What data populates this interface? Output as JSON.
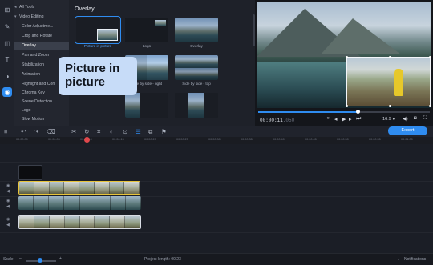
{
  "rail": {
    "icons": [
      "import-icon",
      "effects-icon",
      "filters-icon",
      "titles-icon",
      "stickers-icon",
      "more-tools-icon"
    ],
    "active": "more-tools-icon"
  },
  "tools": {
    "items": [
      {
        "label": "All Tools",
        "caret": "◂",
        "selected": false
      },
      {
        "label": "Video Editing",
        "caret": "▾",
        "selected": false
      },
      {
        "label": "Color Adjustme...",
        "caret": "",
        "selected": false
      },
      {
        "label": "Crop and Rotate",
        "caret": "",
        "selected": false
      },
      {
        "label": "Overlay",
        "caret": "",
        "selected": true
      },
      {
        "label": "Pan and Zoom",
        "caret": "",
        "selected": false
      },
      {
        "label": "Stabilization",
        "caret": "",
        "selected": false
      },
      {
        "label": "Animation",
        "caret": "",
        "selected": false
      },
      {
        "label": "Highlight and Con",
        "caret": "",
        "selected": false
      },
      {
        "label": "Chroma Key",
        "caret": "",
        "selected": false
      },
      {
        "label": "Scene Detection",
        "caret": "",
        "selected": false
      },
      {
        "label": "Logo",
        "caret": "",
        "selected": false
      },
      {
        "label": "Slow Motion",
        "caret": "",
        "selected": false
      }
    ]
  },
  "overlay": {
    "title": "Overlay",
    "tooltip": "Picture in picture",
    "thumbs": [
      {
        "label": "Picture in picture",
        "selected": true
      },
      {
        "label": "Logo",
        "selected": false
      },
      {
        "label": "Overlay",
        "selected": false
      },
      {
        "label": "Side by side - right",
        "selected": false
      },
      {
        "label": "Side by side - top",
        "selected": false
      },
      {
        "label": "",
        "selected": false
      },
      {
        "label": "",
        "selected": false
      }
    ]
  },
  "preview": {
    "timecode_main": "00:00:11",
    "timecode_ms": ".050",
    "progress": 0.58,
    "aspect": "16:9 ▾",
    "controls": [
      "⏮",
      "◂",
      "▶",
      "▸",
      "⏭"
    ]
  },
  "toolbar": {
    "export_label": "Export"
  },
  "ruler": [
    "00:00:00",
    "00:00:05",
    "00:00:10",
    "00:00:15",
    "00:00:20",
    "00:00:25",
    "00:00:30",
    "00:00:35",
    "00:00:40",
    "00:00:45",
    "00:00:50",
    "00:00:55",
    "00:01:00"
  ],
  "status": {
    "scale_label": "Scale",
    "project_length": "Project length: 00:23",
    "notifications": "Notifications"
  },
  "colors": {
    "accent": "#2f8cf0",
    "playhead": "#e0484c",
    "selected_clip_border": "#e8c43a"
  }
}
